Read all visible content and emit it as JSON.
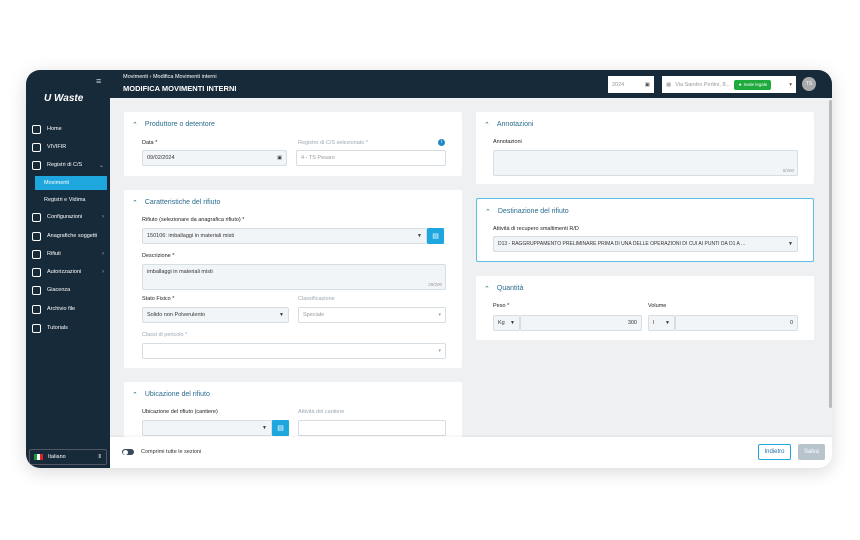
{
  "app": {
    "logo": "Waste"
  },
  "sidebar": {
    "items": [
      {
        "label": "Home",
        "icon": "home-icon"
      },
      {
        "label": "VIVIFIR",
        "icon": "arrows-icon"
      },
      {
        "label": "Registri di C/S",
        "icon": "registers-icon",
        "chevron": "⌄"
      },
      {
        "label": "Movimenti",
        "active": true
      },
      {
        "label": "Registri e Vidima"
      },
      {
        "label": "Configurazioni",
        "icon": "sliders-icon",
        "chevron": "›"
      },
      {
        "label": "Anagrafiche soggetti",
        "icon": "users-icon"
      },
      {
        "label": "Rifiuti",
        "icon": "trash-icon",
        "chevron": "›"
      },
      {
        "label": "Autorizzazioni",
        "icon": "document-icon",
        "chevron": "›"
      },
      {
        "label": "Giacenza",
        "icon": "box-icon"
      },
      {
        "label": "Archivio file",
        "icon": "file-icon"
      },
      {
        "label": "Tutorials",
        "icon": "tutorial-icon"
      }
    ],
    "language": "Italiano"
  },
  "header": {
    "breadcrumb": [
      "Movimenti",
      "Modifica Movimenti interni"
    ],
    "breadcrumb_sep": "›",
    "title": "MODIFICA MOVIMENTI INTERNI",
    "year": "2024",
    "site": "Via Sandro Pertini, 8...",
    "site_badge": "Sede legale",
    "avatar": "TS"
  },
  "produttore": {
    "title": "Produttore o detentore",
    "data_label": "Data *",
    "data_value": "09/02/2024",
    "registro_label": "Registro di C/S selezionato *",
    "registro_value": "4 - TS Pesaro"
  },
  "caratteristiche": {
    "title": "Caratteristiche del rifiuto",
    "rifiuto_label": "Rifiuto (selezionare da anagrafica rifiuto) *",
    "rifiuto_value": "150106: imballaggi in materiali misti",
    "descrizione_label": "Descrizione *",
    "descrizione_value": "imballaggi in materiali misti",
    "descrizione_counter": "29/200",
    "stato_label": "Stato Fisico *",
    "stato_value": "Solido non Polverulento",
    "classificazione_label": "Classificazione",
    "classificazione_value": "Speciale",
    "classi_label": "Classi di pericolo *"
  },
  "ubicazione": {
    "title": "Ubicazione del rifiuto",
    "cantiere_label": "Ubicazione del rifiuto (cantiere)",
    "attivita_label": "Attività del cantiere"
  },
  "annotazioni": {
    "title": "Annotazioni",
    "label": "Annotazioni",
    "counter": "0/200"
  },
  "destinazione": {
    "title": "Destinazione del rifiuto",
    "label": "Attività di recupero smaltimenti R/D",
    "value": "D13 - RAGGRUPPAMENTO PRELIMINARE PRIMA DI UNA DELLE OPERAZIONI DI CUI AI PUNTI DA D1 A ..."
  },
  "quantita": {
    "title": "Quantità",
    "peso_label": "Peso *",
    "peso_unit": "Kg",
    "peso_value": "300",
    "volume_label": "Volume",
    "volume_unit": "l",
    "volume_value": "0"
  },
  "footer": {
    "toggle_label": "Comprimi tutte le sezioni",
    "back": "Indietro",
    "save": "Salva"
  },
  "colors": {
    "sidebar": "#172a3a",
    "accent": "#1ea7df",
    "badge": "#1eaa3c"
  }
}
